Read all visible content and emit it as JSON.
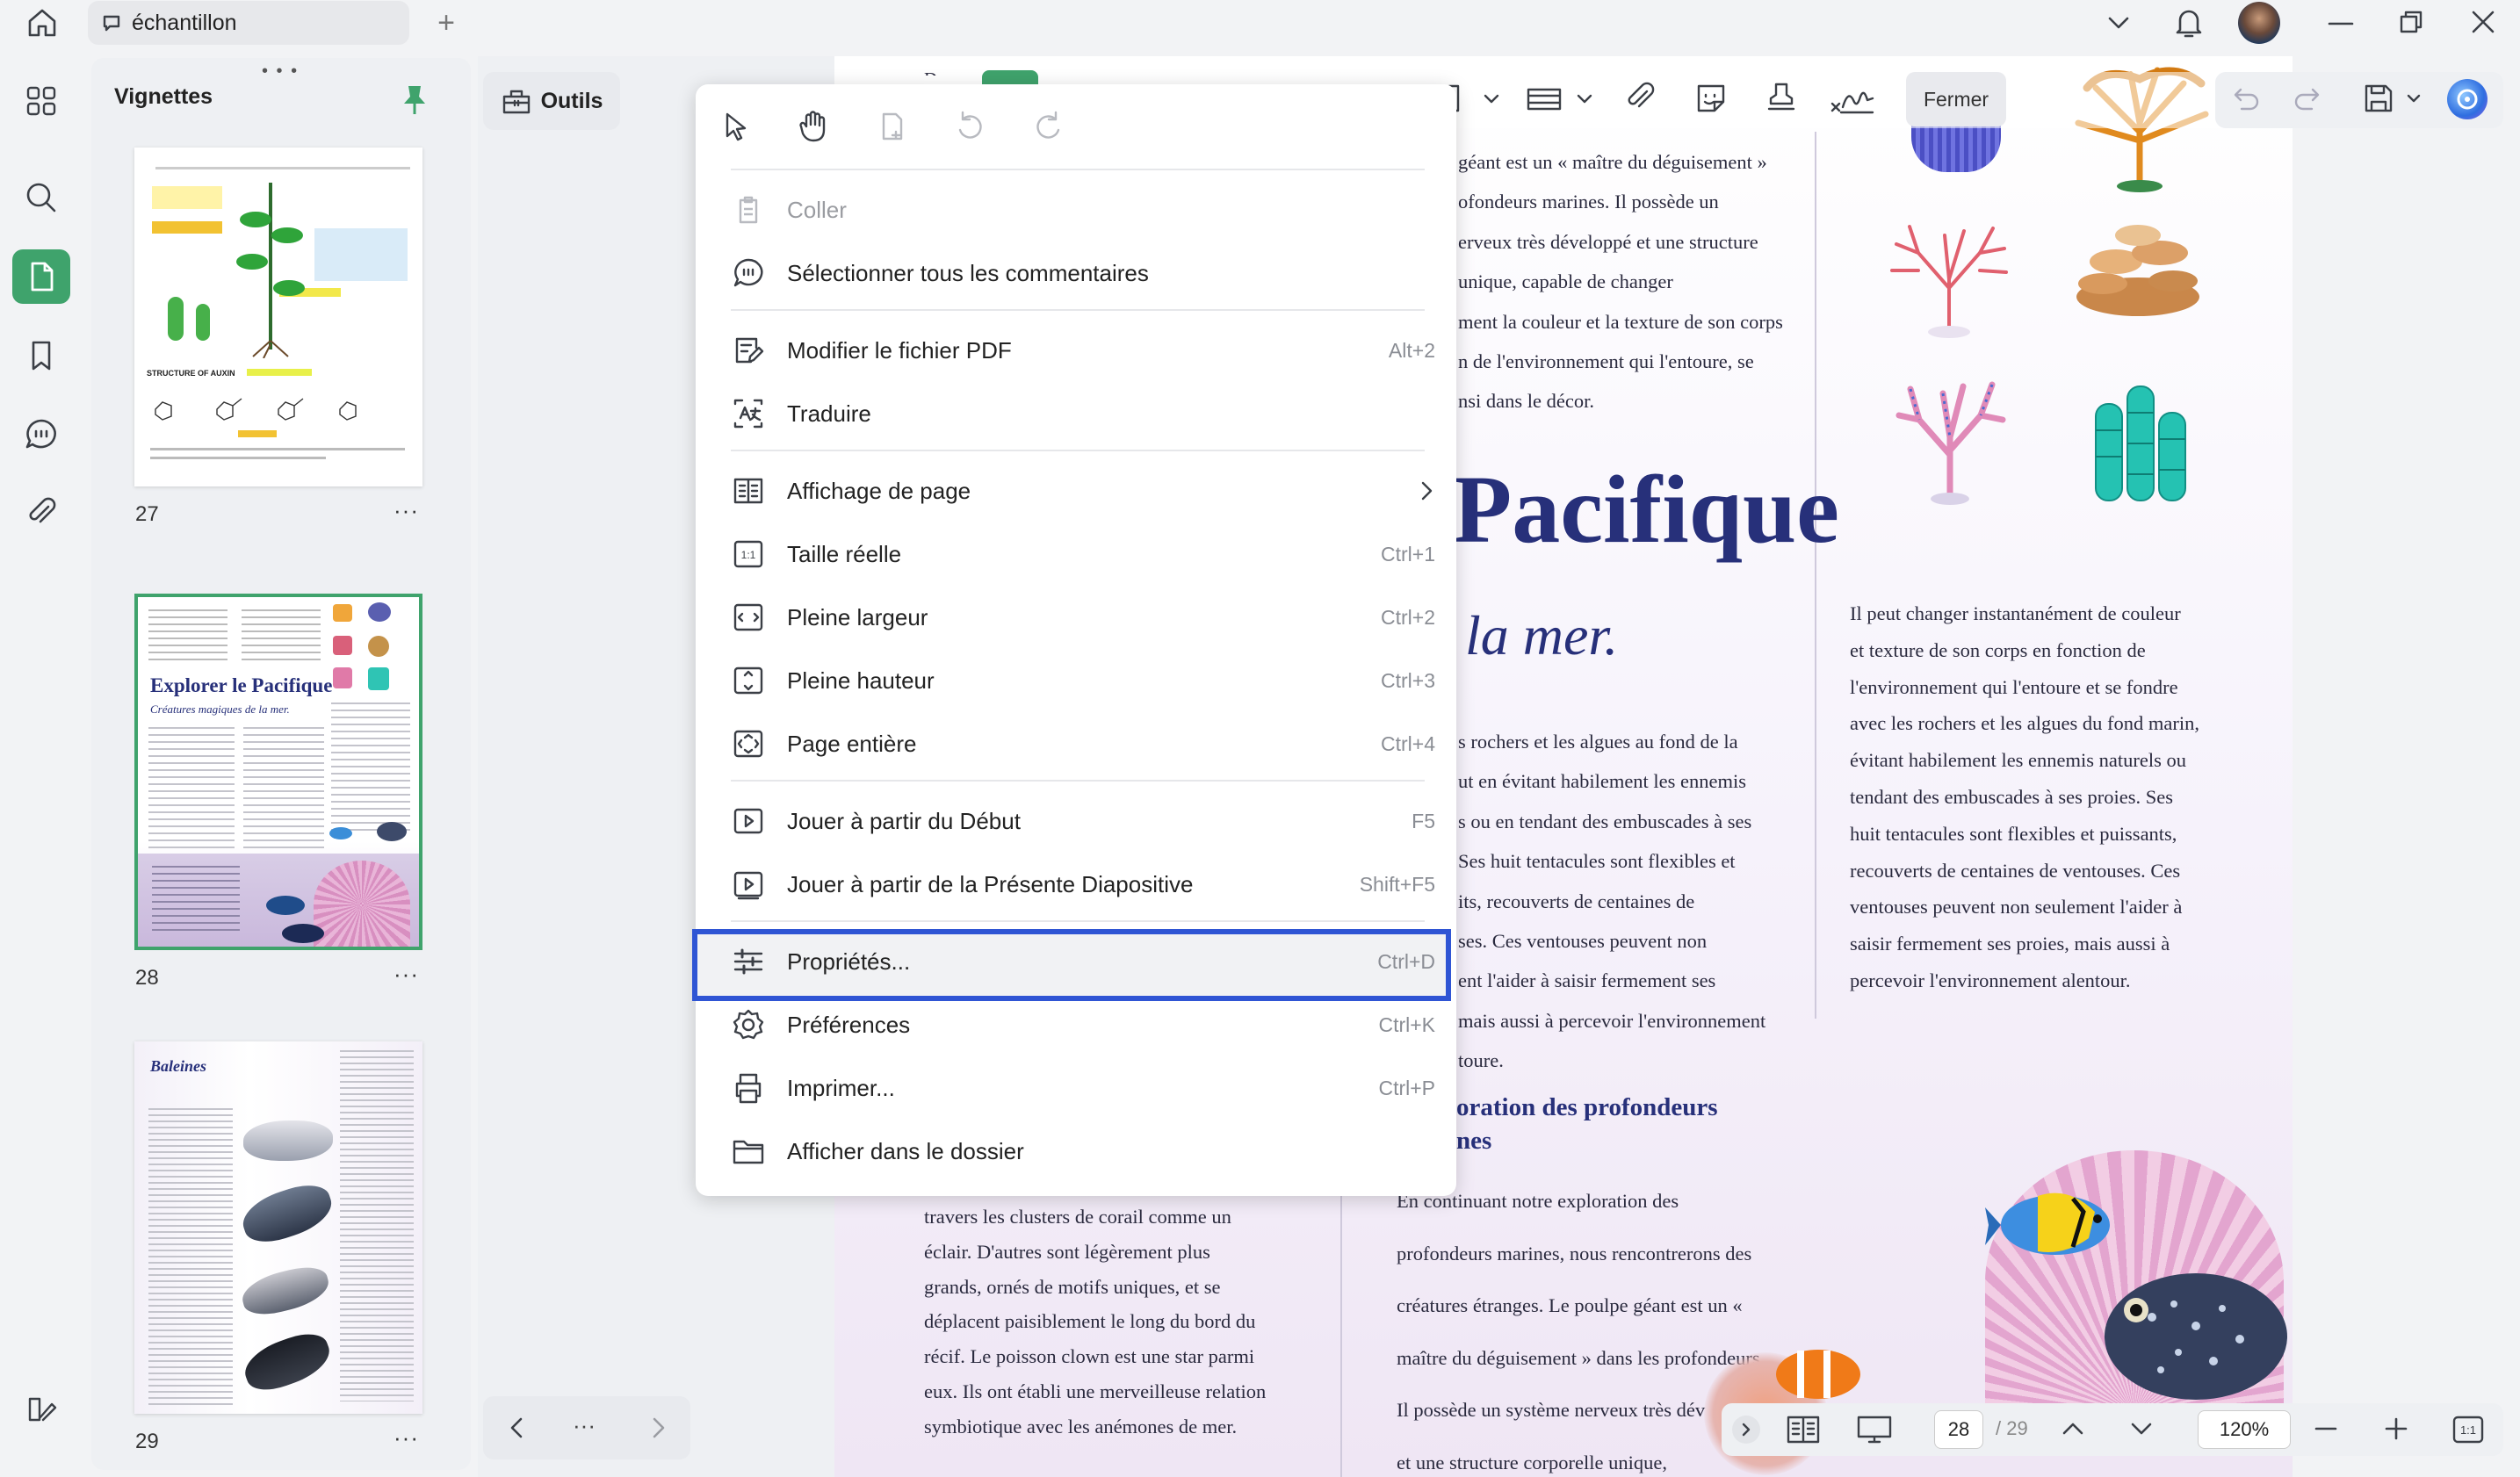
{
  "tab": {
    "title": "échantillon"
  },
  "thumbnails": {
    "title": "Vignettes",
    "pages": [
      {
        "num": "27",
        "more": "···"
      },
      {
        "num": "28",
        "more": "···",
        "headline": "Explorer le Pacifique",
        "subline": "Créatures magiques de la mer."
      },
      {
        "num": "29",
        "more": "···",
        "headline": "Baleines"
      }
    ]
  },
  "toolbar": {
    "tools_label": "Outils",
    "close_label": "Fermer"
  },
  "menu": {
    "items": [
      {
        "label": "Coller",
        "shortcut": "",
        "disabled": true
      },
      {
        "label": "Sélectionner tous les commentaires",
        "shortcut": ""
      },
      {
        "label": "Modifier le fichier PDF",
        "shortcut": "Alt+2"
      },
      {
        "label": "Traduire",
        "shortcut": ""
      },
      {
        "label": "Affichage de page",
        "shortcut": ""
      },
      {
        "label": "Taille réelle",
        "shortcut": "Ctrl+1"
      },
      {
        "label": "Pleine largeur",
        "shortcut": "Ctrl+2"
      },
      {
        "label": "Pleine hauteur",
        "shortcut": "Ctrl+3"
      },
      {
        "label": "Page entière",
        "shortcut": "Ctrl+4"
      },
      {
        "label": "Jouer à partir du Début",
        "shortcut": "F5"
      },
      {
        "label": "Jouer à partir de la Présente Diapositive",
        "shortcut": "Shift+F5"
      },
      {
        "label": "Propriétés...",
        "shortcut": "Ctrl+D"
      },
      {
        "label": "Préférences",
        "shortcut": "Ctrl+K"
      },
      {
        "label": "Imprimer...",
        "shortcut": "Ctrl+P"
      },
      {
        "label": "Afficher dans le dossier",
        "shortcut": ""
      }
    ]
  },
  "document": {
    "top_fragment": "Dans",
    "col2_top": [
      "géant est un « maître du déguisement »",
      "ofondeurs marines. Il possède un",
      "erveux très développé et une structure",
      "unique, capable de changer",
      "ment la couleur et la texture de son corps",
      "n de l'environnement qui l'entoure, se",
      "nsi dans le décor."
    ],
    "heading": "Pacifique",
    "subheading": "la mer.",
    "col2_mid": [
      "s rochers et les algues au fond de la",
      "ut en évitant habilement les ennemis",
      "s ou en tendant des embuscades à ses",
      "Ses huit tentacules sont flexibles et",
      "its, recouverts de centaines de",
      "ses. Ces ventouses peuvent non",
      "ent l'aider à saisir fermement ses",
      "mais aussi à percevoir l'environnement",
      "toure."
    ],
    "section_heading": [
      "oration des profondeurs",
      "nes"
    ],
    "col2_bottom": [
      "En continuant notre exploration des",
      "profondeurs marines, nous rencontrerons des",
      "créatures étranges. Le poulpe géant est un «",
      "maître du déguisement » dans les profondeurs.",
      "Il possède un système nerveux très dév",
      "et une structure corporelle unique,"
    ],
    "col1_bottom": [
      "travers les clusters de corail comme un",
      "éclair. D'autres sont légèrement plus",
      "grands, ornés de motifs uniques, et se",
      "déplacent paisiblement le long du bord du",
      "récif. Le poisson clown est une star parmi",
      "eux. Ils ont établi une merveilleuse relation",
      "symbiotique avec les anémones de mer."
    ],
    "col3": [
      "Il peut changer instantanément de couleur",
      "et texture de son corps en fonction de",
      "l'environnement qui l'entoure et se fondre",
      "avec les rochers et les algues du fond marin,",
      "évitant habilement les ennemis naturels ou",
      "tendant des embuscades à ses proies. Ses",
      "huit tentacules sont flexibles et puissants,",
      "recouverts de centaines de ventouses. Ces",
      "ventouses peuvent non seulement l'aider à",
      "saisir fermement ses proies, mais aussi à",
      "percevoir l'environnement alentour."
    ]
  },
  "pagination": {
    "current": "28",
    "total": "/ 29",
    "zoom": "120%",
    "nav_more": "···"
  },
  "colors": {
    "accent_green": "#3fa36c",
    "highlight_blue": "#2f55d4",
    "heading_navy": "#27307a"
  }
}
